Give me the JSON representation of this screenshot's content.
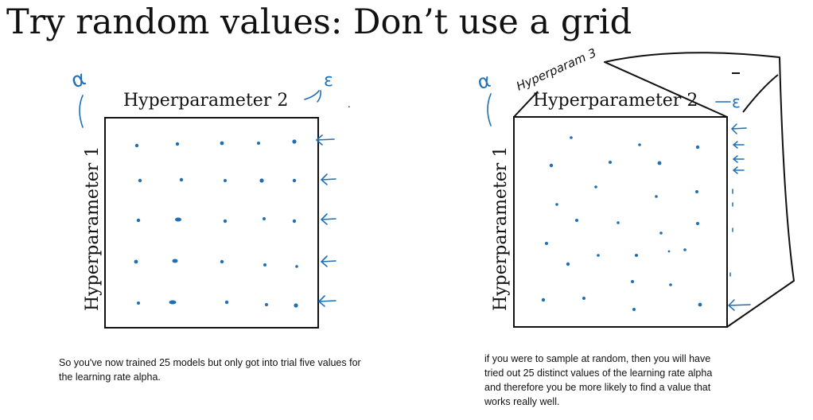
{
  "title": "Try random values: Don’t use a grid",
  "left": {
    "hyperparam_2_label": "Hyperparameter 2",
    "hyperparam_1_label": "Hyperparameter 1",
    "handwritten_top_left": "α",
    "handwritten_top_right": "ε",
    "caption": "So you've now trained 25 models but only got into trial five values for the learning rate alpha."
  },
  "right": {
    "hyperparam_2_label": "Hyperparameter 2",
    "hyperparam_1_label": "Hyperparameter 1",
    "handwritten_top_left": "α",
    "handwritten_hyperparam_3": "Hyperparam 3",
    "handwritten_top_right": "ε",
    "caption": "if you were to sample at random, then you will have tried out 25 distinct values of the learning rate alpha and therefore you be more likely to find a value that works really well."
  },
  "colors": {
    "ink": "#1f6fb5",
    "frame": "#111111"
  }
}
